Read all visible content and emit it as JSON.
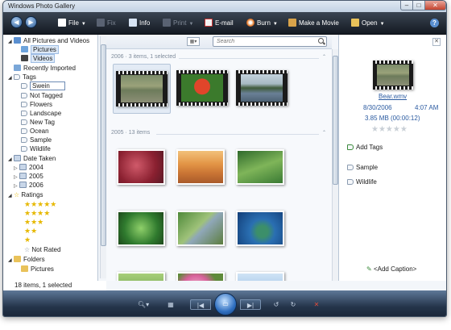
{
  "window": {
    "title": "Windows Photo Gallery"
  },
  "toolbar": {
    "file": "File",
    "fix": "Fix",
    "info": "Info",
    "print": "Print",
    "email": "E-mail",
    "burn": "Burn",
    "make_movie": "Make a Movie",
    "open": "Open"
  },
  "nav": {
    "all": "All Pictures and Videos",
    "pictures": "Pictures",
    "videos": "Videos",
    "recent": "Recently Imported",
    "tags": "Tags",
    "tag_edit_value": "Swein",
    "not_tagged": "Not Tagged",
    "flowers": "Flowers",
    "landscape": "Landscape",
    "new_tag": "New Tag",
    "ocean": "Ocean",
    "sample": "Sample",
    "wildlife": "Wildlife",
    "date_taken": "Date Taken",
    "y2004": "2004",
    "y2005": "2005",
    "y2006": "2006",
    "ratings": "Ratings",
    "r5": "★★★★★",
    "r4": "★★★★",
    "r3": "★★★",
    "r2": "★★",
    "r1": "★",
    "not_rated": "Not Rated",
    "folders": "Folders",
    "folder_pictures": "Pictures"
  },
  "status": {
    "text": "18 items, 1 selected"
  },
  "search": {
    "placeholder": "Search"
  },
  "groups": {
    "g2006": "2006 · 3 items, 1 selected",
    "g2005": "2005 · 13 items"
  },
  "info": {
    "filename": "Bear.wmv",
    "date": "8/30/2006",
    "time": "4:07 AM",
    "size": "3.85 MB (00:00:12)",
    "stars": "★★★★★",
    "add_tags": "Add Tags",
    "tag1": "Sample",
    "tag2": "Wildlife",
    "add_caption": "<Add Caption>"
  },
  "colors": {
    "accent": "#2f6fc0",
    "toolbar_bg": "#1e252f",
    "star": "#e6b800"
  }
}
